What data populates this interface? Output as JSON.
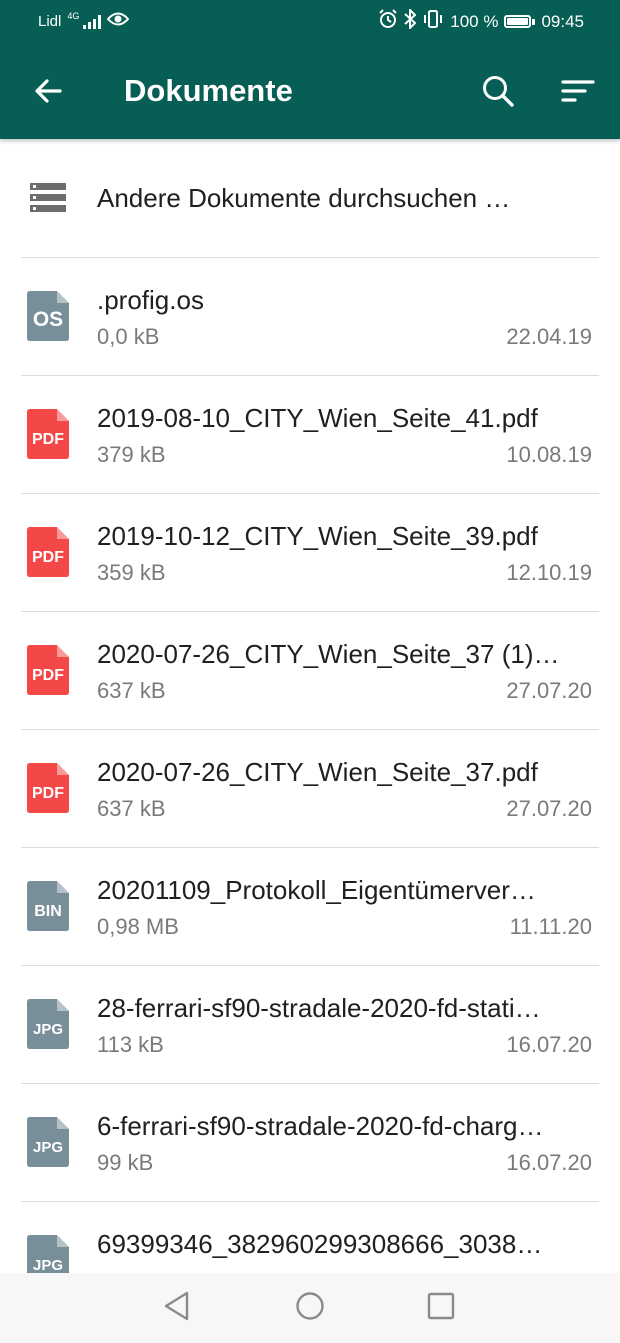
{
  "status_bar": {
    "carrier": "Lidl",
    "network": "4G",
    "battery_percent": "100 %",
    "time": "09:45"
  },
  "appbar": {
    "title": "Dokumente",
    "back_icon": "arrow-back-icon",
    "search_icon": "search-icon",
    "sort_icon": "sort-icon"
  },
  "browse": {
    "label": "Andere Dokumente durchsuchen …"
  },
  "colors": {
    "brand": "#075e54",
    "pdf": "#f44848",
    "generic": "#788f9a"
  },
  "files": [
    {
      "badge": "OS",
      "type": "generic",
      "name": ".profig.os",
      "size": "0,0 kB",
      "date": "22.04.19"
    },
    {
      "badge": "PDF",
      "type": "pdf",
      "name": "2019-08-10_CITY_Wien_Seite_41.pdf",
      "size": "379 kB",
      "date": "10.08.19"
    },
    {
      "badge": "PDF",
      "type": "pdf",
      "name": "2019-10-12_CITY_Wien_Seite_39.pdf",
      "size": "359 kB",
      "date": "12.10.19"
    },
    {
      "badge": "PDF",
      "type": "pdf",
      "name": "2020-07-26_CITY_Wien_Seite_37 (1)…",
      "size": "637 kB",
      "date": "27.07.20"
    },
    {
      "badge": "PDF",
      "type": "pdf",
      "name": "2020-07-26_CITY_Wien_Seite_37.pdf",
      "size": "637 kB",
      "date": "27.07.20"
    },
    {
      "badge": "BIN",
      "type": "generic",
      "name": "20201109_Protokoll_Eigentümerver…",
      "size": "0,98 MB",
      "date": "11.11.20"
    },
    {
      "badge": "JPG",
      "type": "generic",
      "name": "28-ferrari-sf90-stradale-2020-fd-stati…",
      "size": "113 kB",
      "date": "16.07.20"
    },
    {
      "badge": "JPG",
      "type": "generic",
      "name": "6-ferrari-sf90-stradale-2020-fd-charg…",
      "size": "99 kB",
      "date": "16.07.20"
    },
    {
      "badge": "JPG",
      "type": "generic",
      "name": "69399346_382960299308666_3038…",
      "size": "",
      "date": ""
    }
  ],
  "navbar": {
    "back_icon": "nav-back-icon",
    "home_icon": "nav-home-icon",
    "recents_icon": "nav-recents-icon"
  }
}
